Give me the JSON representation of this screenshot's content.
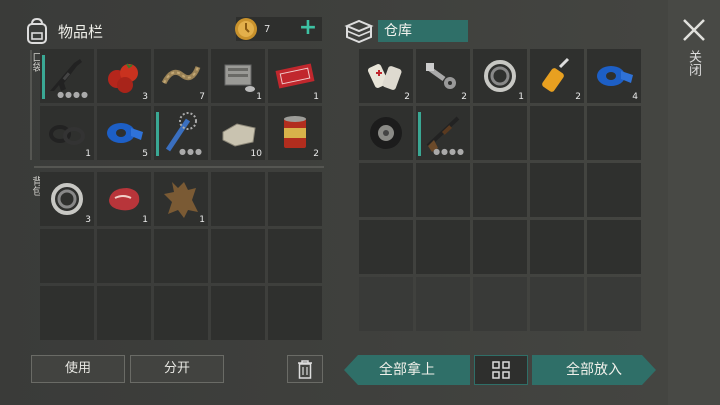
{
  "inventory": {
    "title": "物品栏",
    "pocket_label": "口袋",
    "backpack_label": "背包"
  },
  "coins": {
    "count": "7",
    "plus": "+"
  },
  "storage": {
    "title": "仓库"
  },
  "close": {
    "label": "关闭"
  },
  "pocket_slots": [
    {
      "icon": "assault-rifle-icon",
      "count": "",
      "durability": true
    },
    {
      "icon": "tomatoes-icon",
      "count": "3"
    },
    {
      "icon": "rope-icon",
      "count": "7"
    },
    {
      "icon": "engine-part-icon",
      "count": "1"
    },
    {
      "icon": "coupon-icon",
      "count": "1"
    },
    {
      "icon": "washers-icon",
      "count": "1"
    },
    {
      "icon": "blue-tape-icon",
      "count": "5"
    },
    {
      "icon": "spiked-bat-icon",
      "count": "",
      "durability": true
    },
    {
      "icon": "stone-block-icon",
      "count": "10"
    },
    {
      "icon": "canned-food-icon",
      "count": "2"
    }
  ],
  "backpack_slots": [
    {
      "icon": "bearing-icon",
      "count": "3"
    },
    {
      "icon": "raw-meat-icon",
      "count": "1"
    },
    {
      "icon": "animal-hide-icon",
      "count": "1"
    }
  ],
  "storage_slots": [
    {
      "icon": "first-aid-icon",
      "count": "2"
    },
    {
      "icon": "bolts-icon",
      "count": "2"
    },
    {
      "icon": "bearing-icon",
      "count": "1"
    },
    {
      "icon": "glue-icon",
      "count": "2"
    },
    {
      "icon": "blue-tape-icon",
      "count": "4"
    },
    {
      "icon": "tire-icon",
      "count": ""
    },
    {
      "icon": "shotgun-icon",
      "count": "",
      "durability": true
    }
  ],
  "buttons": {
    "use": "使用",
    "split": "分开",
    "take_all": "全部拿上",
    "put_all": "全部放入"
  }
}
